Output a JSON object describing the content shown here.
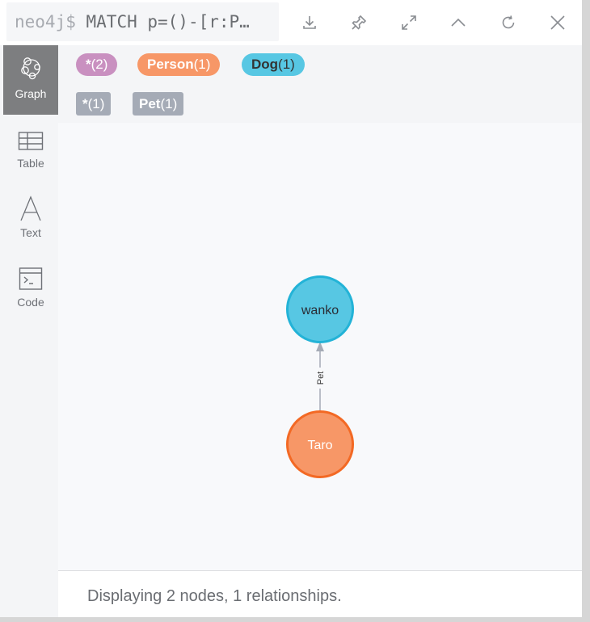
{
  "header": {
    "prompt": "neo4j$",
    "query": "MATCH p=()-[r:P…",
    "buttons": [
      "download-icon",
      "pin-icon",
      "expand-icon",
      "collapse-icon",
      "refresh-icon",
      "close-icon"
    ]
  },
  "sidebar": {
    "items": [
      {
        "label": "Graph",
        "icon": "graph-icon",
        "active": true
      },
      {
        "label": "Table",
        "icon": "table-icon",
        "active": false
      },
      {
        "label": "Text",
        "icon": "text-icon",
        "active": false
      },
      {
        "label": "Code",
        "icon": "code-icon",
        "active": false
      }
    ]
  },
  "legend": {
    "node_labels": [
      {
        "name": "*",
        "count": "(2)",
        "color": "#c990c0"
      },
      {
        "name": "Person",
        "count": "(1)",
        "color": "#f79767"
      },
      {
        "name": "Dog",
        "count": "(1)",
        "color": "#57c7e3"
      }
    ],
    "relationship_types": [
      {
        "name": "*",
        "count": "(1)"
      },
      {
        "name": "Pet",
        "count": "(1)"
      }
    ]
  },
  "graph": {
    "nodes": [
      {
        "id": "wanko",
        "caption": "wanko",
        "label": "Dog",
        "fill": "#57c7e3",
        "stroke": "#23b3d7"
      },
      {
        "id": "taro",
        "caption": "Taro",
        "label": "Person",
        "fill": "#f79767",
        "stroke": "#f36924"
      }
    ],
    "relationships": [
      {
        "type": "Pet",
        "from": "taro",
        "to": "wanko"
      }
    ]
  },
  "footer": {
    "status": "Displaying 2 nodes, 1 relationships."
  }
}
